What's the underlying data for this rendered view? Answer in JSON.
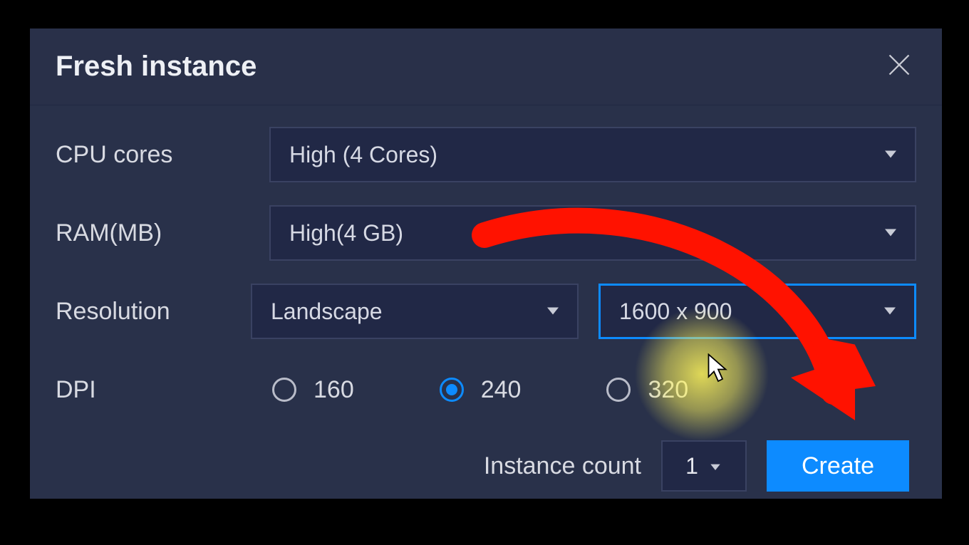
{
  "dialog": {
    "title": "Fresh instance"
  },
  "rows": {
    "cpu": {
      "label": "CPU cores",
      "value": "High (4 Cores)"
    },
    "ram": {
      "label": "RAM(MB)",
      "value": "High(4 GB)"
    },
    "resolution": {
      "label": "Resolution",
      "orientation": "Landscape",
      "size": "1600 x 900"
    },
    "dpi": {
      "label": "DPI",
      "options": [
        "160",
        "240",
        "320"
      ],
      "selected": "240"
    }
  },
  "footer": {
    "instance_count_label": "Instance count",
    "instance_count_value": "1",
    "create_label": "Create"
  }
}
